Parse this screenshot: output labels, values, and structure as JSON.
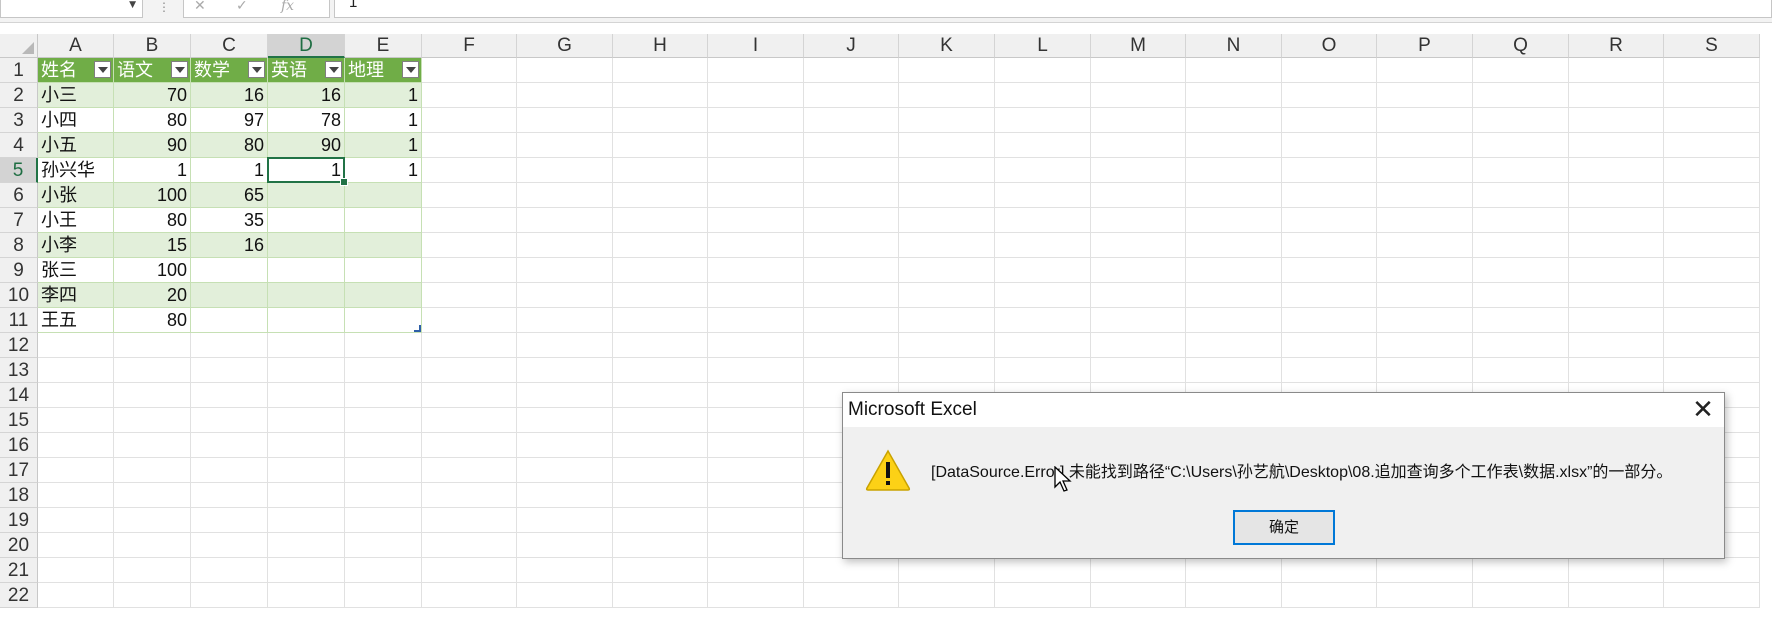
{
  "formula_bar": {
    "name_box": "",
    "cancel_icon": "✕",
    "enter_icon": "✓",
    "fx_icon": "fx",
    "value": "1"
  },
  "columns": [
    "A",
    "B",
    "C",
    "D",
    "E",
    "F",
    "G",
    "H",
    "I",
    "J",
    "K",
    "L",
    "M",
    "N",
    "O",
    "P",
    "Q",
    "R",
    "S"
  ],
  "rows": [
    "1",
    "2",
    "3",
    "4",
    "5",
    "6",
    "7",
    "8",
    "9",
    "10",
    "11",
    "12",
    "13",
    "14",
    "15",
    "16",
    "17",
    "18",
    "19",
    "20",
    "21",
    "22"
  ],
  "table": {
    "headers": [
      "姓名",
      "语文",
      "数学",
      "英语",
      "地理"
    ],
    "rows": [
      [
        "小三",
        "70",
        "16",
        "16",
        "1"
      ],
      [
        "小四",
        "80",
        "97",
        "78",
        "1"
      ],
      [
        "小五",
        "90",
        "80",
        "90",
        "1"
      ],
      [
        "孙兴华",
        "1",
        "1",
        "1",
        "1"
      ],
      [
        "小张",
        "100",
        "65",
        "",
        ""
      ],
      [
        "小王",
        "80",
        "35",
        "",
        ""
      ],
      [
        "小李",
        "15",
        "16",
        "",
        ""
      ],
      [
        "张三",
        "100",
        "",
        "",
        ""
      ],
      [
        "李四",
        "20",
        "",
        "",
        ""
      ],
      [
        "王五",
        "80",
        "",
        "",
        ""
      ]
    ]
  },
  "active_cell": "D5",
  "dialog": {
    "title": "Microsoft Excel",
    "close_label": "✕",
    "message": "[DataSource.Error] 未能找到路径“C:\\Users\\孙艺航\\Desktop\\08.追加查询多个工作表\\数据.xlsx”的一部分。",
    "ok_label": "确定",
    "icon": "warning-icon"
  },
  "colors": {
    "table_header": "#70ad47",
    "table_band": "#e2efda",
    "selection": "#217346",
    "button_focus": "#0078d7"
  }
}
